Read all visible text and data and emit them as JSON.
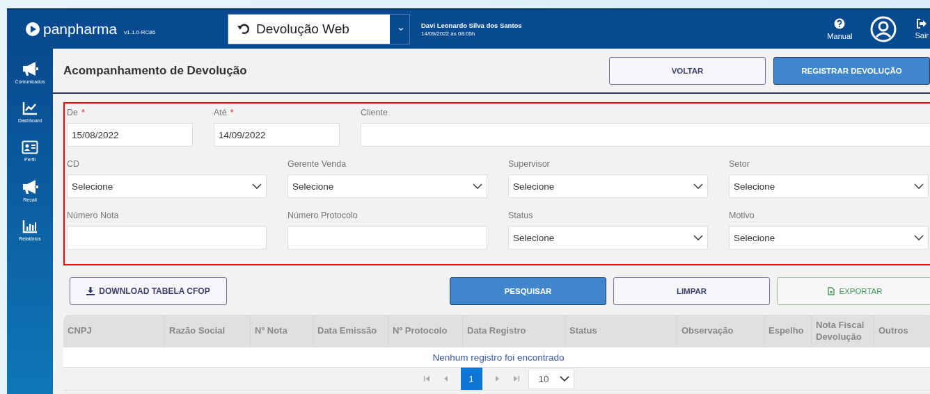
{
  "header": {
    "brand": "panpharma",
    "version": "v1.1.0-RC86",
    "module": "Devolução Web",
    "user": {
      "name": "Davi Leonardo Silva dos Santos",
      "login_time": "14/09/2022 às 08:05h"
    },
    "actions": [
      {
        "kind": "help",
        "label": "Manual"
      },
      {
        "kind": "avatar"
      },
      {
        "kind": "logout",
        "label": "Sair"
      }
    ]
  },
  "sidebar": {
    "items": [
      {
        "kind": "megaphone",
        "label": "Comunicados"
      },
      {
        "kind": "chart",
        "label": "Dashboard"
      },
      {
        "kind": "card",
        "label": "Perfil"
      },
      {
        "kind": "megaphone",
        "label": "Recall"
      },
      {
        "kind": "bars",
        "label": "Relatórios"
      }
    ]
  },
  "page": {
    "title": "Acompanhamento de Devolução",
    "buttons": [
      {
        "kind": "outline",
        "label": "VOLTAR"
      },
      {
        "kind": "primary",
        "label": "REGISTRAR DEVOLUÇÃO"
      }
    ]
  },
  "filters": {
    "rows": [
      [
        {
          "label": "De",
          "required_mark": "*",
          "kind": "text",
          "value": "15/08/2022"
        },
        {
          "label": "Até",
          "required_mark": "*",
          "kind": "text",
          "value": "14/09/2022"
        },
        {
          "label": "Cliente",
          "kind": "text"
        }
      ],
      [
        {
          "label": "CD",
          "kind": "select",
          "value": "Selecione"
        },
        {
          "label": "Gerente Venda",
          "kind": "select",
          "value": "Selecione"
        },
        {
          "label": "Supervisor",
          "kind": "select",
          "value": "Selecione"
        },
        {
          "label": "Setor",
          "kind": "select",
          "value": "Selecione"
        }
      ],
      [
        {
          "label": "Número Nota",
          "kind": "text"
        },
        {
          "label": "Número Protocolo",
          "kind": "text"
        },
        {
          "label": "Status",
          "kind": "select",
          "value": "Selecione"
        },
        {
          "label": "Motivo",
          "kind": "select",
          "value": "Selecione"
        }
      ]
    ]
  },
  "actions": [
    {
      "kind": "download",
      "label": "DOWNLOAD TABELA CFOP"
    },
    {
      "kind": "primary",
      "label": "PESQUISAR"
    },
    {
      "kind": "outline",
      "label": "LIMPAR"
    },
    {
      "kind": "export",
      "label": "EXPORTAR"
    }
  ],
  "table": {
    "columns": [
      "CNPJ",
      "Razão Social",
      "Nº Nota",
      "Data Emissão",
      "Nº Protocolo",
      "Data Registro",
      "Status",
      "Observação",
      "Espelho",
      "Nota Fiscal Devolução",
      "Outros"
    ],
    "empty_message": "Nenhum registro foi encontrado",
    "pager": {
      "pages": [
        {
          "label": "1",
          "selected": true
        }
      ],
      "page_size": "10"
    }
  }
}
